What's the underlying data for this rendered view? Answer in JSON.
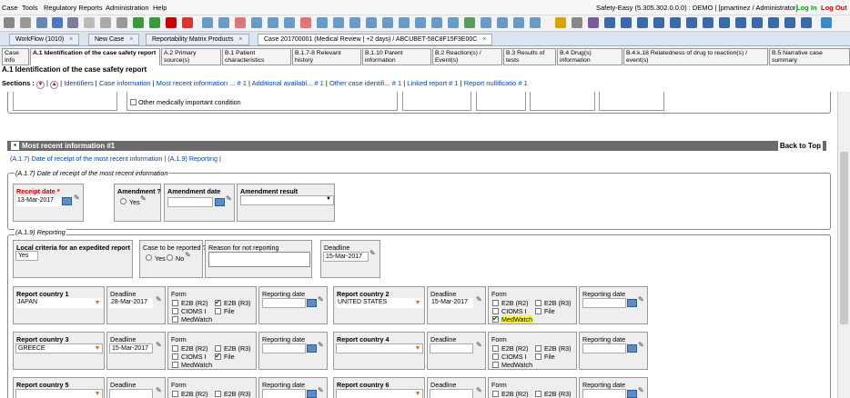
{
  "menu": {
    "case": "Case",
    "tools": "Tools",
    "regulatory": "Regulatory Reports",
    "administration": "Administration",
    "help": "Help"
  },
  "app": {
    "info": "Safety-Easy (5.305.302.0.0.0) : DEMO | [pmartinez / Administrator]",
    "login": "Log In",
    "logout": "Log Out"
  },
  "doc_tabs": [
    {
      "label": "WorkFlow (1010)"
    },
    {
      "label": "New Case"
    },
    {
      "label": "Reportability Matrix Products"
    },
    {
      "label": "Case 201700001 (Medical Review | +2 days) / ABCUBET-58C8F15F3E00C"
    }
  ],
  "section_tabs": [
    {
      "label": "Case Info"
    },
    {
      "label": "A.1 Identification of the case safety report"
    },
    {
      "label": "A.2 Primary source(s)"
    },
    {
      "label": "B.1 Patient characteristics"
    },
    {
      "label": "B.1.7-8 Relevant history"
    },
    {
      "label": "B.1.10 Parent information"
    },
    {
      "label": "B.2 Reaction(s) / Event(s)"
    },
    {
      "label": "B.3 Results of tests"
    },
    {
      "label": "B.4 Drug(s) information"
    },
    {
      "label": "B.4.k.18 Relatedness of drug to reaction(s) / event(s)"
    },
    {
      "label": "B.5 Narrative case summary"
    }
  ],
  "page_title": "A.1 Identification of the case safety report",
  "sections": {
    "label": "Sections :",
    "links": [
      "Identifiers",
      "Case information",
      "Most recent information ... # 1",
      "Additional availabl... # 1",
      "Other case identifi... # 1",
      "Linked report # 1",
      "Report nullificatio # 1"
    ]
  },
  "upper": {
    "other_medically": "Other medically important condition"
  },
  "most_recent": {
    "title": "Most recent information #1",
    "back_to_top": "Back to Top",
    "links": "(A.1.7) Date of receipt of the most recent information | (A.1.9) Reporting |",
    "group_a17": "(A.1.7) Date of receipt of the most recent information",
    "receipt_date_label": "Receipt date *",
    "receipt_date": "13-Mar-2017",
    "amendment_label": "Amendment ?",
    "amendment_yes": "Yes",
    "amendment_date_label": "Amendment date",
    "amendment_result_label": "Amendment result",
    "group_a19": "(A.1.9) Reporting",
    "local_criteria_label": "Local criteria for an expedited report",
    "local_criteria": "Yes",
    "to_be_reported_label": "Case to be reported ?",
    "yes": "Yes",
    "no": "No",
    "reason_label": "Reason for not reporting",
    "deadline_label": "Deadline",
    "deadline": "15-Mar-2017"
  },
  "form_labels": {
    "deadline": "Deadline",
    "form": "Form",
    "reporting_date": "Reporting date",
    "e2b_r2": "E2B (R2)",
    "e2b_r3": "E2B (R3)",
    "cioms": "CIOMS I",
    "file": "File",
    "medwatch": "MedWatch"
  },
  "countries": [
    {
      "label": "Report country 1",
      "value": "JAPAN",
      "deadline": "28-Mar-2017",
      "checked": [
        "e2b_r3"
      ]
    },
    {
      "label": "Report country 2",
      "value": "UNITED STATES",
      "deadline": "15-Mar-2017",
      "checked": [
        "medwatch"
      ]
    },
    {
      "label": "Report country 3",
      "value": "GREECE",
      "deadline": "15-Mar-2017",
      "checked": [
        "file"
      ]
    },
    {
      "label": "Report country 4",
      "value": "",
      "deadline": "",
      "checked": []
    },
    {
      "label": "Report country 5",
      "value": "",
      "deadline": "",
      "checked": []
    },
    {
      "label": "Report country 6",
      "value": "",
      "deadline": "",
      "checked": []
    }
  ],
  "colors": {
    "highlight": "#ffff33",
    "link": "#0645ad",
    "section_bar": "#6b6b6b"
  }
}
